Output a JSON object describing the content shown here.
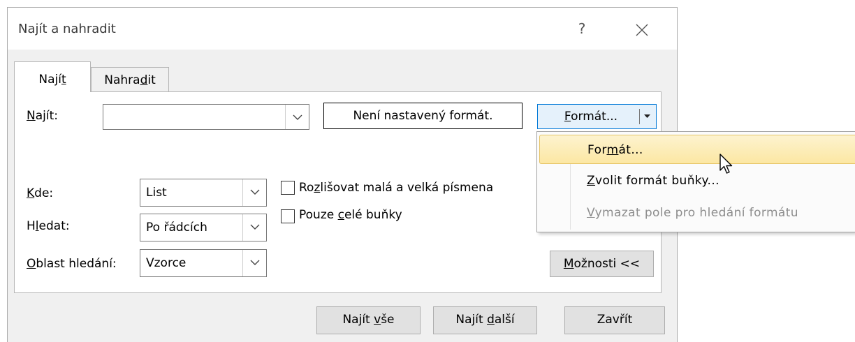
{
  "dialog": {
    "title": "Najít a nahradit",
    "help_label": "?"
  },
  "tabs": [
    {
      "label_pre": "Nají",
      "label_key": "t",
      "label_post": "",
      "active": true
    },
    {
      "label_pre": "Nahra",
      "label_key": "d",
      "label_post": "it",
      "active": false
    }
  ],
  "find": {
    "label_key": "N",
    "label_rest": "ajít:",
    "value": "",
    "format_status": "Není nastavený formát.",
    "format_button_key": "F",
    "format_button_rest": "ormát..."
  },
  "options": {
    "within": {
      "label_key": "K",
      "label_rest": "de:",
      "value": "List"
    },
    "search": {
      "label_pre": "H",
      "label_key": "l",
      "label_rest": "edat:",
      "value": "Po řádcích"
    },
    "look_in": {
      "label_key": "O",
      "label_rest": "blast hledání:",
      "value": "Vzorce"
    },
    "match_case": {
      "label_pre": "Ro",
      "label_key": "z",
      "label_rest": "lišovat malá a velká písmena",
      "checked": false
    },
    "entire_cells": {
      "label_pre": "Pouze ",
      "label_key": "c",
      "label_rest": "elé buňky",
      "checked": false
    },
    "options_button": {
      "label_key": "M",
      "label_rest": "ožnosti <<"
    }
  },
  "format_menu": {
    "items": [
      {
        "pre": "For",
        "key": "m",
        "post": "át...",
        "state": "highlighted"
      },
      {
        "pre": "",
        "key": "Z",
        "post": "volit formát buňky...",
        "state": "enabled"
      },
      {
        "pre": "",
        "key": "V",
        "post": "ymazat pole pro hledání formátu",
        "state": "disabled"
      }
    ]
  },
  "buttons": {
    "find_all": {
      "pre": "Najít ",
      "key": "v",
      "post": "še"
    },
    "find_next": {
      "pre": "Najít ",
      "key": "d",
      "post": "alší"
    },
    "close": {
      "label": "Zavřít"
    }
  },
  "colors": {
    "dialog_bg": "#f0f0f0",
    "focus_border": "#0078d7",
    "menu_highlight": "#fce7a3",
    "disabled_text": "#8d8d8d"
  }
}
